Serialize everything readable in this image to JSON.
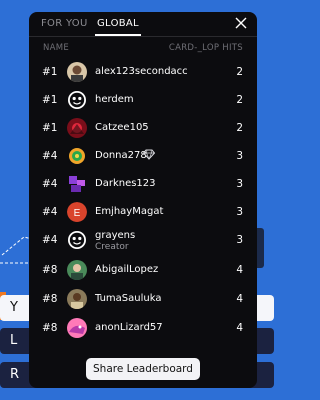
{
  "background": {
    "buttons": [
      "Y",
      "L",
      "R"
    ]
  },
  "modal": {
    "tabs": [
      {
        "label": "FOR YOU",
        "active": false
      },
      {
        "label": "GLOBAL",
        "active": true
      }
    ],
    "columns": {
      "name": "NAME",
      "hits": "CARD-_LOP HITS"
    },
    "rows": [
      {
        "rank": "#1",
        "name": "alex123secondacc",
        "hits": "2",
        "avatar": "person-photo"
      },
      {
        "rank": "#1",
        "name": "herdem",
        "hits": "2",
        "avatar": "face-icon"
      },
      {
        "rank": "#1",
        "name": "Catzee105",
        "hits": "2",
        "avatar": "red-artwork"
      },
      {
        "rank": "#4",
        "name": "Donna278",
        "hits": "3",
        "avatar": "green-badge",
        "badge": "diamond-icon"
      },
      {
        "rank": "#4",
        "name": "Darknes123",
        "hits": "3",
        "avatar": "purple-blocks"
      },
      {
        "rank": "#4",
        "name": "EmjhayMagat",
        "hits": "3",
        "avatar": "letter-E",
        "avatar_letter": "E"
      },
      {
        "rank": "#4",
        "name": "grayens",
        "sub": "Creator",
        "hits": "3",
        "avatar": "face-icon"
      },
      {
        "rank": "#8",
        "name": "AbigailLopez",
        "hits": "4",
        "avatar": "green-photo"
      },
      {
        "rank": "#8",
        "name": "TumaSauluka",
        "hits": "4",
        "avatar": "photo"
      },
      {
        "rank": "#8",
        "name": "anonLizard57",
        "hits": "4",
        "avatar": "pink-lizard"
      }
    ],
    "share_label": "Share Leaderboard"
  },
  "colors": {
    "backdrop": "#2d6fd6",
    "modal_bg": "#0c0c0f",
    "accent": "#f07a22"
  }
}
